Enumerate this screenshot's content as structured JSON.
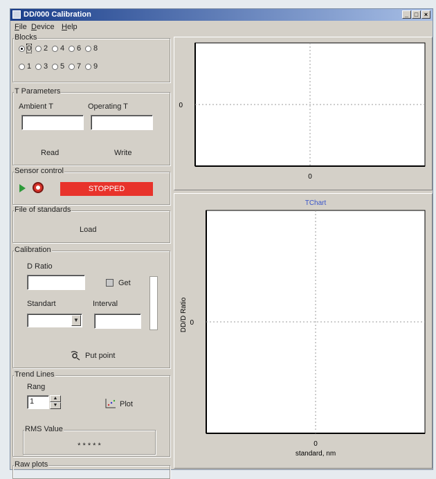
{
  "window": {
    "title": "DD/000 Calibration",
    "minimize": "_",
    "maximize": "□",
    "close": "×"
  },
  "menu": {
    "file": "File",
    "device": "Device",
    "help": "Help"
  },
  "blocks": {
    "label": "Blocks",
    "row1": [
      "0",
      "2",
      "4",
      "6",
      "8"
    ],
    "row2": [
      "1",
      "3",
      "5",
      "7",
      "9"
    ],
    "selected": "0"
  },
  "t_parameters": {
    "label": "T Parameters",
    "ambient_label": "Ambient T",
    "operating_label": "Operating T",
    "ambient_value": "",
    "operating_value": "",
    "read": "Read",
    "write": "Write"
  },
  "sensor_control": {
    "label": "Sensor control",
    "status": "STOPPED",
    "status_color": "#e8332b"
  },
  "file_of_standards": {
    "label": "File of standards",
    "load": "Load"
  },
  "calibration": {
    "label": "Calibration",
    "d_ratio_label": "D Ratio",
    "d_ratio_value": "",
    "get": "Get",
    "standard_label": "Standart",
    "standard_value": "",
    "interval_label": "Interval",
    "interval_value": "",
    "put_point": "Put point"
  },
  "trend_lines": {
    "label": "Trend Lines",
    "rang_label": "Rang",
    "rang_value": "1",
    "plot": "Plot",
    "rms_label": "RMS Value",
    "rms_value": "* * * * *"
  },
  "cut_off_group_label": "Raw plots",
  "chart_data": [
    {
      "type": "line",
      "title": "",
      "xlabel": "",
      "ylabel": "",
      "x_ticks": [
        "0"
      ],
      "y_ticks": [
        "0"
      ],
      "series": [],
      "grid": "center-dashed"
    },
    {
      "type": "line",
      "title": "TChart",
      "xlabel": "standard, nm",
      "ylabel": "DD/D Ratio",
      "x_ticks": [
        "0"
      ],
      "y_ticks": [
        "0"
      ],
      "series": [],
      "grid": "center-dashed"
    }
  ]
}
